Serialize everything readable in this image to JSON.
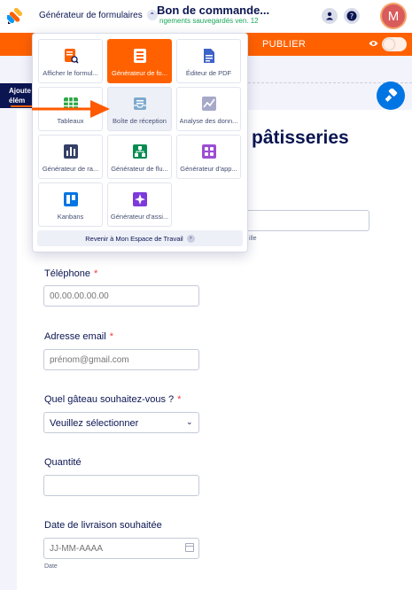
{
  "topbar": {
    "app_switcher_label": "Générateur de formulaires",
    "form_title": "Bon de commande...",
    "save_status": "ngements sauvegardés ven. 12",
    "avatar_initial": "M"
  },
  "orange_bar": {
    "publish_label": "PUBLIER"
  },
  "sidebar": {
    "add_element_line1": "Ajoute",
    "add_element_line2": "élém"
  },
  "products": [
    {
      "label": "Afficher le formul...",
      "icon": "form-view-icon",
      "color": "#ff6100"
    },
    {
      "label": "Générateur de fo...",
      "icon": "form-builder-icon",
      "color": "#ff6100",
      "active": true
    },
    {
      "label": "Éditeur de PDF",
      "icon": "pdf-editor-icon",
      "color": "#3e62c8"
    },
    {
      "label": "Tableaux",
      "icon": "tables-icon",
      "color": "#2ca745"
    },
    {
      "label": "Boîte de réception",
      "icon": "inbox-icon",
      "color": "#7eaacd"
    },
    {
      "label": "Analyse des donn...",
      "icon": "analytics-icon",
      "color": "#a7a9c9"
    },
    {
      "label": "Générateur de ra...",
      "icon": "report-builder-icon",
      "color": "#344067"
    },
    {
      "label": "Générateur de flu...",
      "icon": "workflow-builder-icon",
      "color": "#078c52"
    },
    {
      "label": "Générateur d'app...",
      "icon": "app-builder-icon",
      "color": "#9c4dd3"
    },
    {
      "label": "Kanbans",
      "icon": "kanban-icon",
      "color": "#0075e3"
    },
    {
      "label": "Générateur d'assi...",
      "icon": "ai-agent-builder-icon",
      "color": "#7d3adb"
    }
  ],
  "back_to_workspace": "Revenir à Mon Espace de Travail",
  "form": {
    "heading": "pâtisseries",
    "name_sublabel": "ille",
    "phone": {
      "label": "Téléphone",
      "placeholder": "00.00.00.00.00"
    },
    "email": {
      "label": "Adresse email",
      "placeholder": "prénom@gmail.com"
    },
    "cake": {
      "label": "Quel gâteau souhaitez-vous ?",
      "value": "Veuillez sélectionner"
    },
    "quantity": {
      "label": "Quantité",
      "value": ""
    },
    "date": {
      "label": "Date de livraison souhaitée",
      "placeholder": "JJ-MM-AAAA",
      "sublabel": "Date"
    },
    "required_mark": "*"
  },
  "colors": {
    "accent": "#ff6100",
    "navy": "#0a1551",
    "blue": "#0075e3"
  }
}
